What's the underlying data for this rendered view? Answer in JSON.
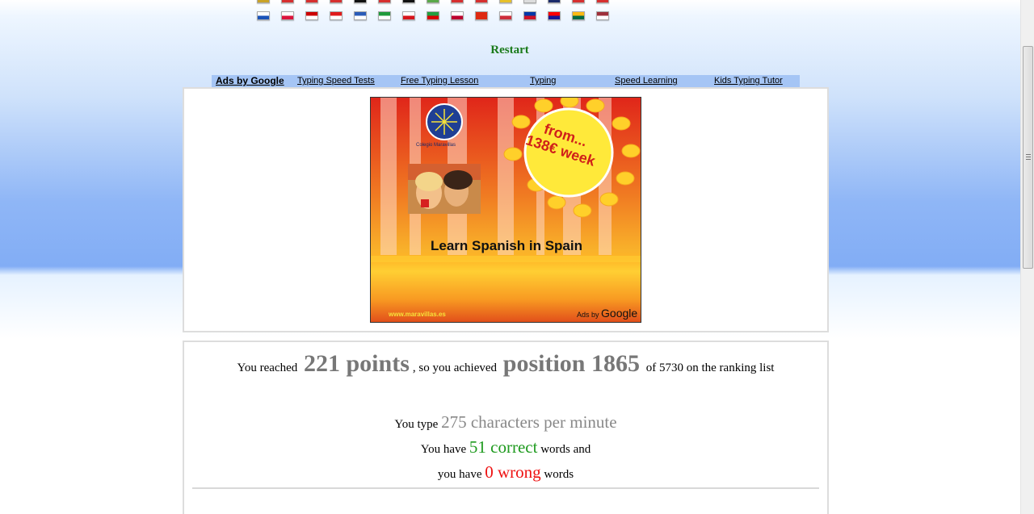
{
  "flags_top": [
    "#c9a227",
    "#d62f2f",
    "#d62f2f",
    "#d62f2f",
    "#111111",
    "#d62f2f",
    "#111111",
    "#5aa84a",
    "#d62f2f",
    "#d62f2f",
    "#e6c02a",
    "#dddddd",
    "#1a2a6a",
    "#d62f2f",
    "#d62f2f"
  ],
  "flags_second": [
    {
      "name": "finland-flag-icon",
      "colors": [
        "#ffffff",
        "#1a53b8"
      ]
    },
    {
      "name": "poland-flag-icon",
      "colors": [
        "#ffffff",
        "#dc143c"
      ]
    },
    {
      "name": "malaysia-flag-icon",
      "colors": [
        "#cc0000",
        "#ffffff"
      ]
    },
    {
      "name": "indonesia-flag-icon",
      "colors": [
        "#e01a1a",
        "#ffffff"
      ]
    },
    {
      "name": "greece-flag-icon",
      "colors": [
        "#2a5cb8",
        "#ffffff"
      ]
    },
    {
      "name": "esperanto-flag-icon",
      "colors": [
        "#1e9a3a",
        "#ffffff"
      ]
    },
    {
      "name": "czech-flag-icon",
      "colors": [
        "#ffffff",
        "#d7141a"
      ]
    },
    {
      "name": "iran-flag-icon",
      "colors": [
        "#239f40",
        "#da0000"
      ]
    },
    {
      "name": "japan-flag-icon",
      "colors": [
        "#ffffff",
        "#bc002d"
      ]
    },
    {
      "name": "china-flag-icon",
      "colors": [
        "#de2910",
        "#de2910"
      ]
    },
    {
      "name": "korea-flag-icon",
      "colors": [
        "#ffffff",
        "#cd2e3a"
      ]
    },
    {
      "name": "philippines-flag-icon",
      "colors": [
        "#0038a8",
        "#ce1126"
      ]
    },
    {
      "name": "croatia-flag-icon",
      "colors": [
        "#ff0000",
        "#171796"
      ]
    },
    {
      "name": "lithuania-flag-icon",
      "colors": [
        "#fdb913",
        "#006a44"
      ]
    },
    {
      "name": "latvia-flag-icon",
      "colors": [
        "#9e3039",
        "#ffffff"
      ]
    }
  ],
  "restart_label": "Restart",
  "ad_links": {
    "ads_by": "Ads by Google",
    "items": [
      "Typing Speed Tests",
      "Free Typing Lesson",
      "Typing",
      "Speed Learning",
      "Kids Typing Tutor"
    ]
  },
  "banner": {
    "school": "Colegio Maravillas",
    "price_line1": "from...",
    "price_line2": "138€ week",
    "headline": "Learn Spanish in Spain",
    "site": "www.maravillas.es",
    "ads_by_prefix": "Ads by",
    "ads_by_brand": "Google"
  },
  "results": {
    "reached_prefix": "You reached",
    "points": "221 points",
    "achieved_text": ", so you achieved",
    "position": "position 1865",
    "of_text": "of 5730 on the ranking list",
    "type_prefix": "You type",
    "cpm": "275 characters per minute",
    "have_prefix": "You have",
    "correct": "51 correct",
    "correct_suffix": "words and",
    "have_prefix2": "you have",
    "wrong": "0 wrong",
    "wrong_suffix": "words"
  },
  "colors": {
    "restart": "#1a7a1a",
    "correct": "#1e9a1e",
    "wrong": "#ee1111",
    "stat_grey": "#888888",
    "ad_bar": "#a5c5f5"
  }
}
